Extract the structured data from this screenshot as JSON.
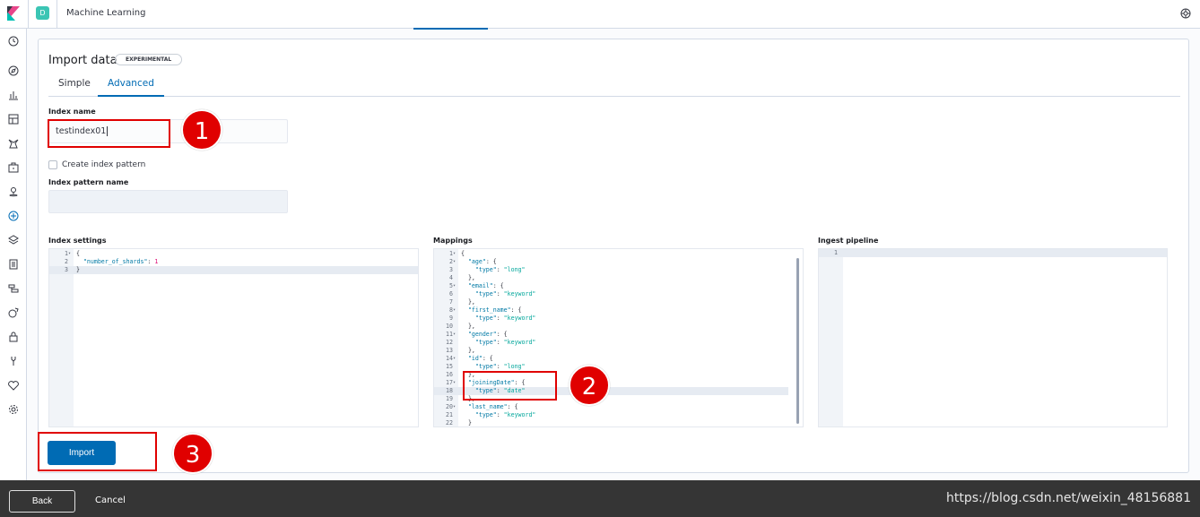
{
  "header": {
    "space_initial": "D",
    "app_title": "Machine Learning"
  },
  "nav_icons": [
    "clock-icon",
    "compass-icon",
    "bar-chart-icon",
    "dashboard-icon",
    "canvas-icon",
    "briefcase-icon",
    "map-pin-icon",
    "machine-learning-icon",
    "stack-icon",
    "logs-icon",
    "apm-icon",
    "uptime-icon",
    "dev-tools-icon",
    "heartbeat-icon",
    "gear-icon"
  ],
  "panel": {
    "title": "Import data",
    "badge": "EXPERIMENTAL",
    "tabs": [
      "Simple",
      "Advanced"
    ],
    "selected_tab": "Advanced"
  },
  "form": {
    "index_name_label": "Index name",
    "index_name_value": "testindex01",
    "create_pattern_label": "Create index pattern",
    "create_pattern_checked": false,
    "pattern_name_label": "Index pattern name",
    "pattern_name_value": ""
  },
  "editors": {
    "settings_label": "Index settings",
    "mappings_label": "Mappings",
    "pipeline_label": "Ingest pipeline"
  },
  "buttons": {
    "import": "Import",
    "back": "Back",
    "cancel": "Cancel"
  },
  "annotations": [
    "1",
    "2",
    "3"
  ],
  "watermark": "https://blog.csdn.net/weixin_48156881",
  "colors": {
    "accent": "#006bb4",
    "annotation_red": "#e00000"
  }
}
